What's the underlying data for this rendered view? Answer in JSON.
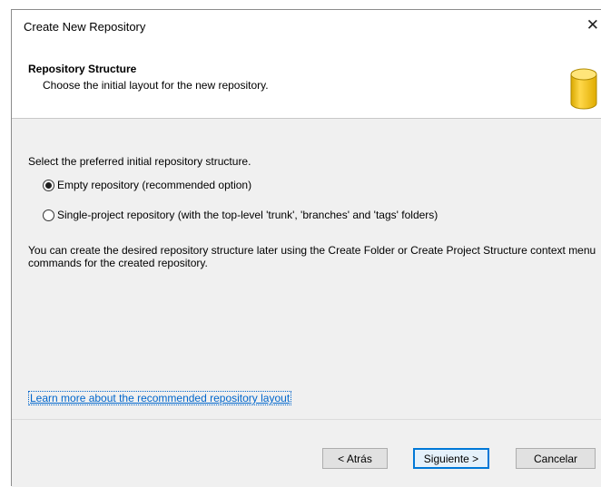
{
  "window": {
    "title": "Create New Repository",
    "close_glyph": "✕"
  },
  "banner": {
    "title": "Repository Structure",
    "subtitle": "Choose the initial layout for the new repository.",
    "icon": "database-icon",
    "icon_color": "#f5c400"
  },
  "content": {
    "prompt": "Select the preferred initial repository structure.",
    "options": [
      {
        "label": "Empty repository (recommended option)",
        "checked": true
      },
      {
        "label": "Single-project repository (with the top-level 'trunk', 'branches' and 'tags' folders)",
        "checked": false
      }
    ],
    "info": "You can create the desired repository structure later using the Create Folder or Create Project Structure context menu commands for the created repository.",
    "link": "Learn more about the recommended repository layout"
  },
  "footer": {
    "back_label": "< Atrás",
    "next_label": "Siguiente >",
    "cancel_label": "Cancelar"
  }
}
